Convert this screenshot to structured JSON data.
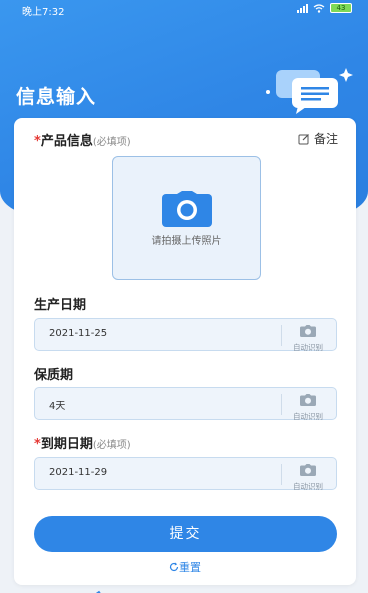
{
  "status": {
    "time": "晚上7:32",
    "battery": "43"
  },
  "header": {
    "title": "信息输入"
  },
  "product": {
    "required_mark": "*",
    "label": "产品信息",
    "hint": "(必填项)",
    "note_label": "备注",
    "upload_text": "请拍摄上传照片"
  },
  "production_date": {
    "label": "生产日期",
    "value": "2021-11-25",
    "ocr_label": "自动识别"
  },
  "shelf_life": {
    "label": "保质期",
    "value": "4天",
    "ocr_label": "自动识别"
  },
  "expiry_date": {
    "required_mark": "*",
    "label": "到期日期",
    "hint": "(必填项)",
    "value": "2021-11-29",
    "ocr_label": "自动识别"
  },
  "actions": {
    "submit_label": "提交",
    "reset_label": "重置"
  },
  "colors": {
    "primary": "#2f86e6",
    "required": "#e53935"
  }
}
